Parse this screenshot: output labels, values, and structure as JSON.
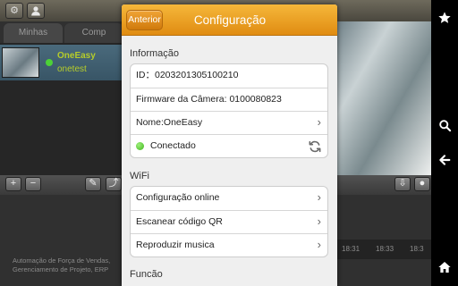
{
  "background": {
    "tabs": [
      "Minhas",
      "Comp"
    ],
    "camera_list": [
      {
        "name": "OneEasy",
        "subtitle": "onetest",
        "online": true
      }
    ],
    "footer_text": "Automação de Força de Vendas, Gerenciamento de Projeto, ERP",
    "timeline": [
      "18:31",
      "18:33",
      "18:3"
    ]
  },
  "dialog": {
    "back_label": "Anterior",
    "title": "Configuração",
    "sections": {
      "info": {
        "label": "Informação",
        "id_text": "ID：0203201305100210",
        "firmware_text": "Firmware da Câmera: 0100080823",
        "name_text": "Nome:OneEasy",
        "status_text": "Conectado"
      },
      "wifi": {
        "label": "WiFi",
        "items": [
          "Configuração online",
          "Escanear código QR",
          "Reproduzir musica"
        ]
      },
      "function": {
        "label": "Funcão"
      }
    }
  },
  "icons": {
    "gear": "gear-icon",
    "user": "user-icon",
    "star": "star-icon",
    "search": "search-icon",
    "back_arrow": "back-arrow-icon",
    "home": "home-icon",
    "chevron": "chevron-right-icon",
    "refresh": "refresh-icon"
  },
  "colors": {
    "header_orange": "#ee9f1f",
    "status_green": "#3fb51c",
    "camera_name": "#b6cc2a"
  }
}
